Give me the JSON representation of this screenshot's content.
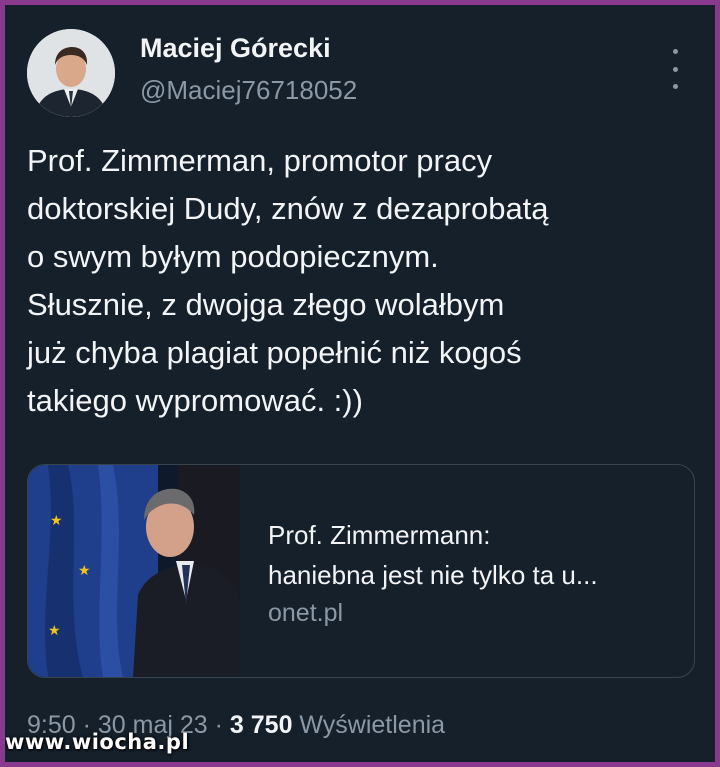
{
  "author": {
    "name": "Maciej Górecki",
    "handle": "@Maciej76718052"
  },
  "tweet": {
    "lines": [
      "Prof. Zimmerman, promotor pracy",
      "doktorskiej Dudy, znów z dezaprobatą",
      "o swym byłym podopiecznym.",
      "Słusznie, z dwojga złego wolałbym",
      "już chyba plagiat popełnić niż kogoś",
      "takiego wypromować. :))"
    ]
  },
  "link_card": {
    "title_line1": "Prof. Zimmermann:",
    "title_line2": "haniebna jest nie tylko ta u...",
    "domain": "onet.pl"
  },
  "meta": {
    "time": "9:50",
    "separator1": " · ",
    "date": "30 maj 23",
    "separator2": " · ",
    "views_count": "3 750",
    "views_label": " Wyświetlenia"
  },
  "watermark": "www.wiocha.pl",
  "colors": {
    "background": "#15202b",
    "border": "#8a3a8e",
    "text": "#f2f4f5",
    "muted": "#8b98a5"
  },
  "icons": [
    "more-options-icon"
  ]
}
